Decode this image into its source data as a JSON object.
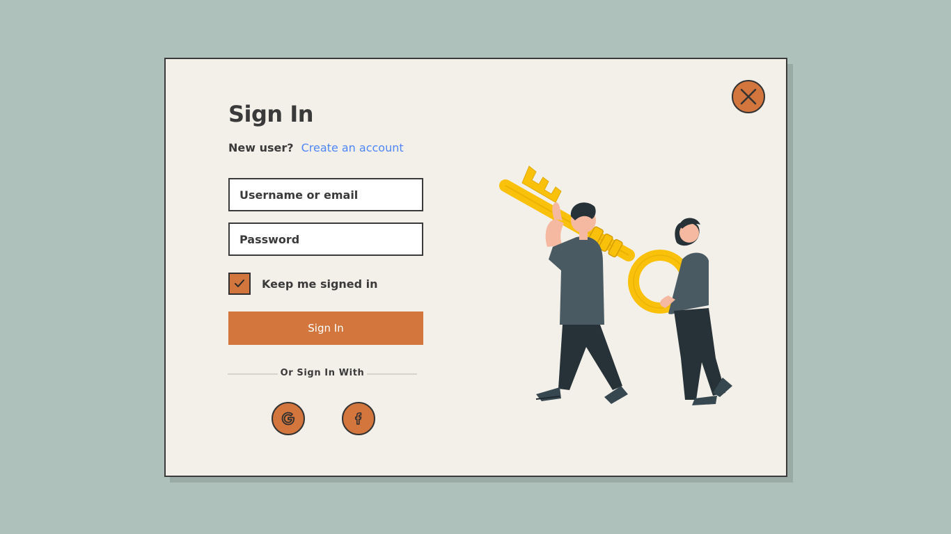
{
  "colors": {
    "background": "#aec1bb",
    "modal": "#f3f0e9",
    "accent": "#d3763d",
    "link": "#4f86f7",
    "text": "#3a3a3a",
    "key": "#f9c10a"
  },
  "dialog": {
    "title": "Sign In",
    "close_icon": "close-icon"
  },
  "signup": {
    "prompt": "New user?",
    "link_label": "Create an account"
  },
  "form": {
    "username_placeholder": "Username or email",
    "username_value": "",
    "password_placeholder": "Password",
    "password_value": "",
    "remember_label": "Keep me signed in",
    "remember_checked": true,
    "submit_label": "Sign In"
  },
  "social": {
    "divider_label": "Or Sign In With",
    "providers": [
      {
        "name": "Google",
        "icon": "google-icon"
      },
      {
        "name": "Facebook",
        "icon": "facebook-icon"
      }
    ]
  },
  "illustration": {
    "subject": "two people carrying a large golden key",
    "icon": "key-illustration"
  }
}
